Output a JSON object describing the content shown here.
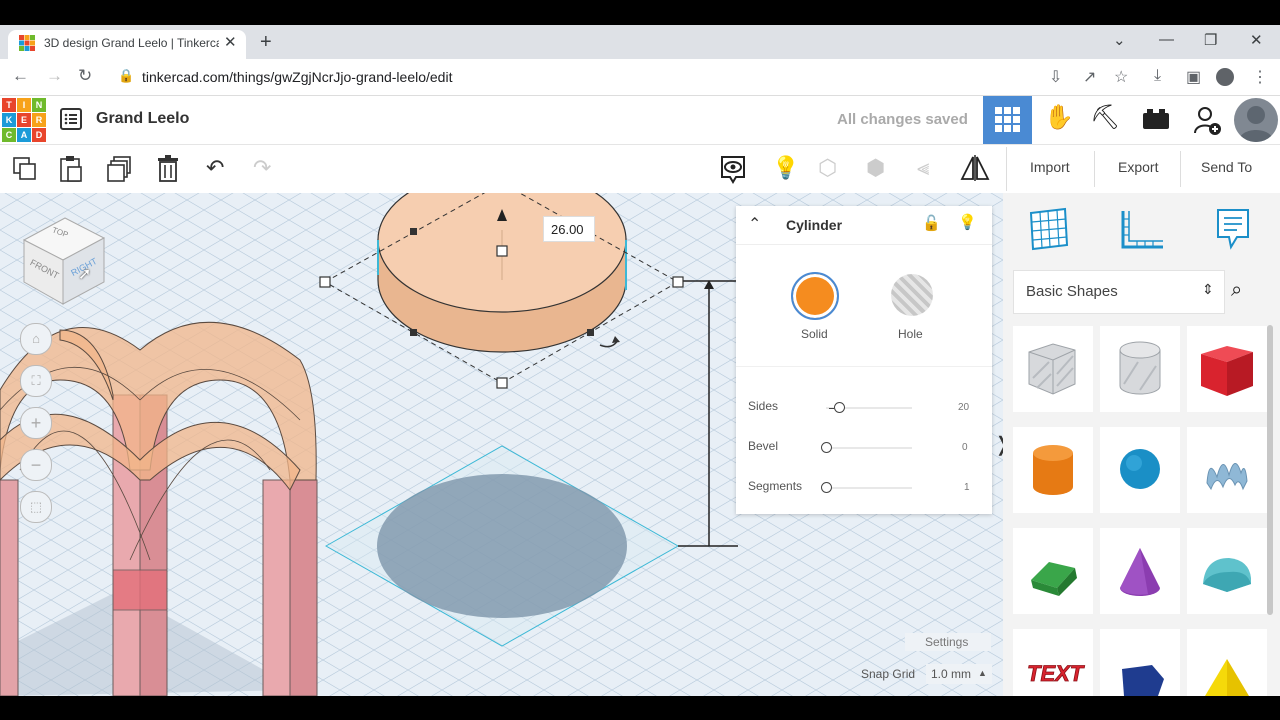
{
  "browser": {
    "tab_title": "3D design Grand Leelo | Tinkercad",
    "url": "tinkercad.com/things/gwZgjNcrJjo-grand-leelo/edit"
  },
  "app": {
    "logo_letters": [
      "T",
      "I",
      "N",
      "K",
      "E",
      "R",
      "C",
      "A",
      "D"
    ],
    "design_title": "Grand Leelo",
    "save_status": "All changes saved"
  },
  "toolbar": {
    "import_label": "Import",
    "export_label": "Export",
    "send_to_label": "Send To"
  },
  "viewcube": {
    "top": "TOP",
    "front": "FRONT",
    "right": "RIGHT"
  },
  "dimension_value": "26.00",
  "inspector": {
    "title": "Cylinder",
    "solid_label": "Solid",
    "hole_label": "Hole",
    "solid_color": "#f58c1f",
    "params": [
      {
        "label": "Sides",
        "value": "20",
        "fraction": 0.1
      },
      {
        "label": "Bevel",
        "value": "0",
        "fraction": 0
      },
      {
        "label": "Segments",
        "value": "1",
        "fraction": 0
      }
    ]
  },
  "library": {
    "category": "Basic Shapes",
    "shapes": [
      "Box Hole",
      "Cylinder Hole",
      "Box",
      "Cylinder",
      "Sphere",
      "Scribble",
      "Roof",
      "Cone",
      "Round Roof",
      "Text",
      "Cube Prism",
      "Pyramid"
    ]
  },
  "bottom": {
    "settings_label": "Settings",
    "snap_grid_label": "Snap Grid",
    "snap_grid_value": "1.0 mm"
  }
}
